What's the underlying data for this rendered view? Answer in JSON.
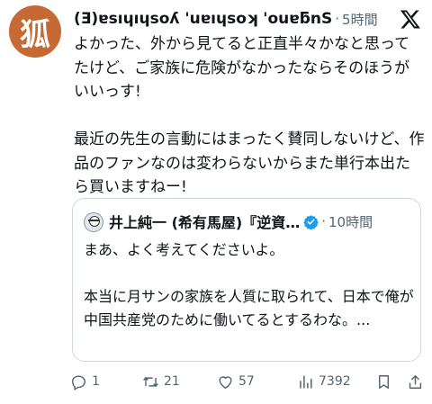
{
  "post": {
    "avatar_glyph": "狐",
    "display_name": "(Ǝ)ɐsıɥıɥsoʎ 'uɐıɥsoʞ 'ouɐƃnS",
    "separator": "·",
    "time": "5時間",
    "text": "よかった、外から見てると正直半々かなと思ってたけど、ご家族に危険がなかったならそのほうがいいっす!\n\n最近の先生の言動にはまったく賛同しないけど、作品のファンなのは変わらないからまた単行本出たら買いますねー!"
  },
  "quote": {
    "display_name": "井上純一 (希有馬屋)『逆資…",
    "separator": "·",
    "time": "10時間",
    "text": "まあ、よく考えてくださいよ。\n\n本当に月サンの家族を人質に取られて、日本で俺が中国共産党のために働いてるとするわな。..."
  },
  "actions": {
    "replies": "1",
    "reposts": "21",
    "likes": "57",
    "views": "7392"
  },
  "icons": [
    "x-logo-icon",
    "verified-badge-icon",
    "reply-icon",
    "repost-icon",
    "like-icon",
    "views-icon",
    "bookmark-icon",
    "share-icon"
  ],
  "colors": {
    "verified": "#1d9bf0",
    "secondary_text": "#536471",
    "border": "#cfd9de",
    "avatar": "#c66a35"
  }
}
